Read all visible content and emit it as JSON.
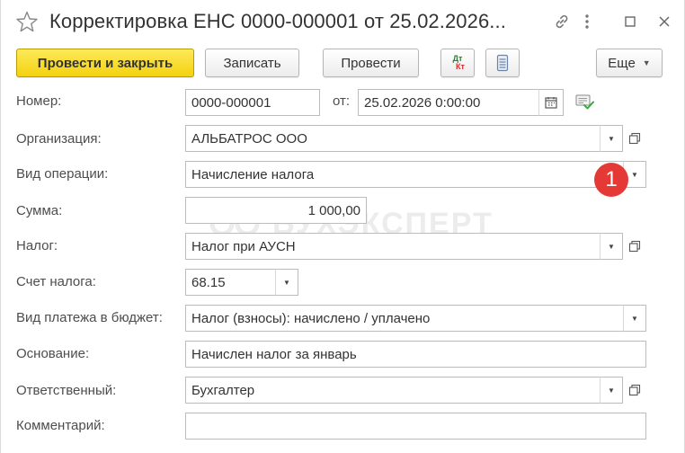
{
  "window": {
    "title": "Корректировка ЕНС 0000-000001 от 25.02.2026..."
  },
  "toolbar": {
    "post_close_label": "Провести и закрыть",
    "save_label": "Записать",
    "post_label": "Провести",
    "dtkt_top": "Дт",
    "dtkt_bottom": "Кт",
    "more_label": "Еще"
  },
  "form": {
    "number": {
      "label": "Номер:",
      "value": "0000-000001"
    },
    "date": {
      "label": "от:",
      "value": "25.02.2026  0:00:00"
    },
    "organization": {
      "label": "Организация:",
      "value": "АЛЬБАТРОС ООО"
    },
    "operation_type": {
      "label": "Вид операции:",
      "value": "Начисление налога"
    },
    "amount": {
      "label": "Сумма:",
      "value": "1 000,00"
    },
    "tax": {
      "label": "Налог:",
      "value": "Налог при АУСН"
    },
    "tax_account": {
      "label": "Счет налога:",
      "value": "68.15"
    },
    "payment_type": {
      "label": "Вид платежа в бюджет:",
      "value": "Налог (взносы): начислено / уплачено"
    },
    "basis": {
      "label": "Основание:",
      "value": "Начислен налог за январь"
    },
    "responsible": {
      "label": "Ответственный:",
      "value": "Бухгалтер"
    },
    "comment": {
      "label": "Комментарий:",
      "value": ""
    }
  },
  "watermark": "БУХЭКСПЕРТ",
  "callout": {
    "number": "1",
    "color": "#e53935"
  },
  "colors": {
    "primary_button": "#f4d20f",
    "accent_green": "#3aa845"
  },
  "icons": [
    "star-icon",
    "link-icon",
    "more-vertical-icon",
    "maximize-icon",
    "close-icon",
    "calendar-icon",
    "document-check-icon",
    "dropdown-icon",
    "open-icon",
    "list-icon"
  ]
}
